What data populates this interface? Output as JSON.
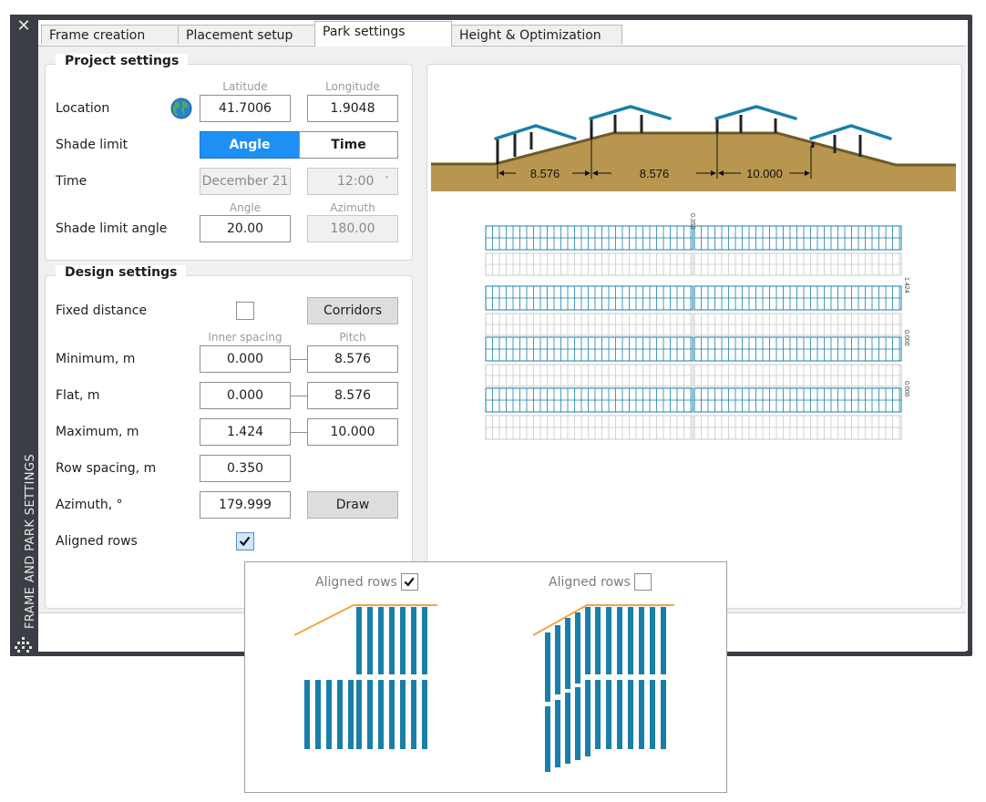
{
  "palette": {
    "side_title": "FRAME AND PARK SETTINGS",
    "tabs": [
      {
        "label": "Frame creation"
      },
      {
        "label": "Placement setup"
      },
      {
        "label": "Park settings"
      },
      {
        "label": "Height & Optimization"
      }
    ],
    "active_tab": "Park settings"
  },
  "project_settings": {
    "title": "Project settings",
    "location_label": "Location",
    "latitude_header": "Latitude",
    "longitude_header": "Longitude",
    "latitude": "41.7006",
    "longitude": "1.9048",
    "shade_limit_label": "Shade limit",
    "shade_limit_options": [
      "Angle",
      "Time"
    ],
    "shade_limit_selected": "Angle",
    "time_label": "Time",
    "date_value": "December 21",
    "time_value": "12:00",
    "angle_header": "Angle",
    "azimuth_header": "Azimuth",
    "shade_limit_angle_label": "Shade limit angle",
    "shade_angle": "20.00",
    "shade_azimuth": "180.00"
  },
  "design_settings": {
    "title": "Design settings",
    "fixed_distance_label": "Fixed distance",
    "fixed_distance_checked": false,
    "corridors_label": "Corridors",
    "inner_spacing_header": "Inner spacing",
    "pitch_header": "Pitch",
    "minimum_label": "Minimum, m",
    "minimum_inner": "0.000",
    "minimum_pitch": "8.576",
    "flat_label": "Flat, m",
    "flat_inner": "0.000",
    "flat_pitch": "8.576",
    "maximum_label": "Maximum, m",
    "maximum_inner": "1.424",
    "maximum_pitch": "10.000",
    "row_spacing_label": "Row spacing, m",
    "row_spacing": "0.350",
    "azimuth_label": "Azimuth, °",
    "azimuth": "179.999",
    "draw_label": "Draw",
    "aligned_rows_label": "Aligned rows",
    "aligned_rows_checked": true
  },
  "preview": {
    "dimension_labels": [
      "8.576",
      "8.576",
      "10.000"
    ],
    "plan_small_labels": [
      "0.350",
      "1.424",
      "0.000",
      "0.000"
    ],
    "colors": {
      "terrain": "#b8964f",
      "terrain_edge": "#6e5a2a",
      "panel": "#1a7fa8",
      "frame": "#222222"
    }
  },
  "inset": {
    "left_label": "Aligned rows",
    "left_checked": true,
    "right_label": "Aligned rows",
    "right_checked": false,
    "colors": {
      "panel": "#1a7fa8",
      "slope": "#f5a540"
    }
  }
}
